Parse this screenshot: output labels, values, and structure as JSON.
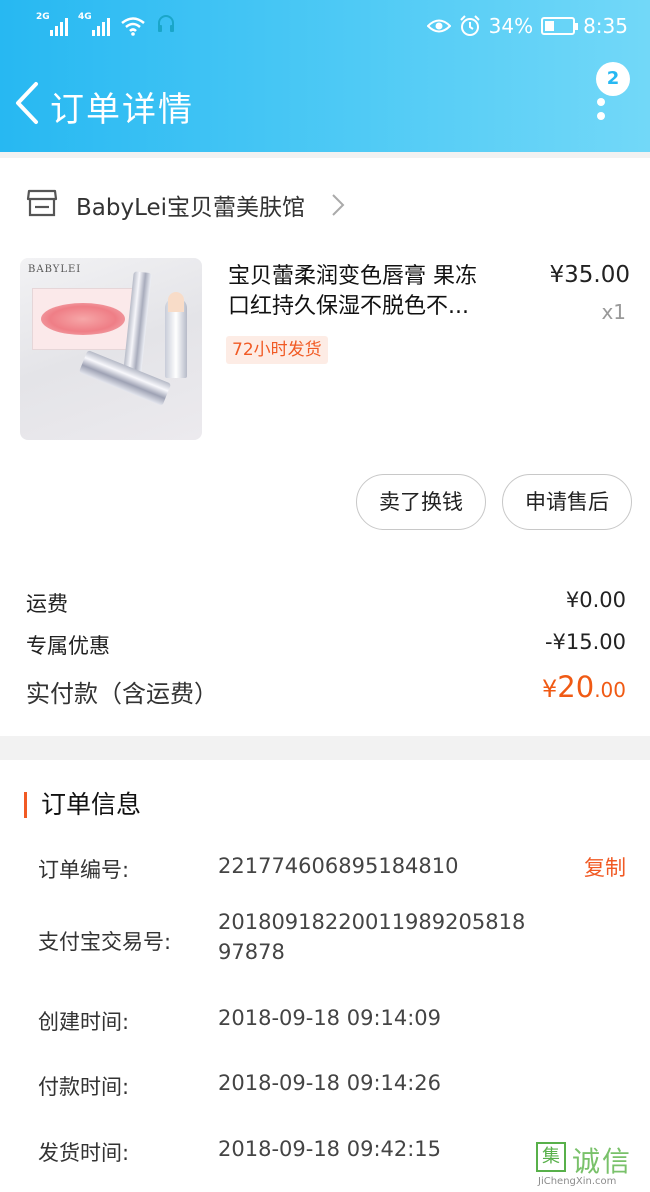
{
  "status_bar": {
    "signal1_tag": "2G",
    "signal2_tag": "4G",
    "battery_percent": "34%",
    "battery_level": 0.34,
    "time": "8:35"
  },
  "header": {
    "title": "订单详情",
    "badge_count": "2"
  },
  "shop": {
    "name": "BabyLei宝贝蕾美肤馆"
  },
  "product": {
    "image_brand_text": "BABYLEI",
    "title_line1": "宝贝蕾柔润变色唇膏 果冻",
    "title_line2": "口红持久保湿不脱色不...",
    "price": "¥35.00",
    "quantity": "x1",
    "shipping_tag": "72小时发货"
  },
  "actions": {
    "sell_label": "卖了换钱",
    "aftersale_label": "申请售后"
  },
  "summary": {
    "freight_label": "运费",
    "freight_value": "¥0.00",
    "discount_label": "专属优惠",
    "discount_value": "-¥15.00",
    "total_label": "实付款（含运费）",
    "total_currency": "¥",
    "total_int": "20",
    "total_dec": ".00"
  },
  "order_info": {
    "title": "订单信息",
    "copy_label": "复制",
    "rows": [
      {
        "label": "订单编号:",
        "value": "221774606895184810"
      },
      {
        "label": "支付宝交易号:",
        "value_line1": "20180918220011989205818",
        "value_line2": "97878"
      },
      {
        "label": "创建时间:",
        "value": "2018-09-18 09:14:09"
      },
      {
        "label": "付款时间:",
        "value": "2018-09-18 09:14:26"
      },
      {
        "label": "发货时间:",
        "value": "2018-09-18 09:42:15"
      }
    ]
  },
  "watermark": {
    "box_char": "集",
    "cn_text": "诚信",
    "en_text": "JiChengXin.com"
  },
  "colors": {
    "header_start": "#27b8f2",
    "header_end": "#72d8f8",
    "accent_orange": "#f15a24"
  },
  "icons": {
    "back": "chevron-left-icon",
    "more": "more-vertical-icon",
    "store": "store-icon",
    "shop_arrow": "chevron-right-icon",
    "eye": "eye-icon",
    "alarm": "alarm-icon",
    "wifi": "wifi-icon"
  }
}
